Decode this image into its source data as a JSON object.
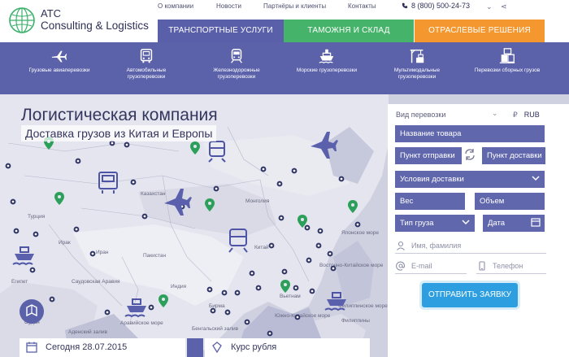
{
  "brand": {
    "line1": "ATC",
    "line2": "Consulting & Logistics"
  },
  "topnav": [
    "О компании",
    "Новости",
    "Партнёры и клиенты",
    "Контакты"
  ],
  "phone": "8 (800) 500-24-73",
  "tabs": [
    {
      "label": "ТРАНСПОРТНЫЕ УСЛУГИ",
      "color": "#595fa8"
    },
    {
      "label": "ТАМОЖНЯ И СКЛАД",
      "color": "#46b36b"
    },
    {
      "label": "ОТРАСЛЕВЫЕ РЕШЕНИЯ",
      "color": "#f4972e"
    }
  ],
  "services": [
    {
      "label": "Грузовые авиаперевозки",
      "icon": "airplane-icon"
    },
    {
      "label": "Автомобильные грузоперевозки",
      "icon": "truck-icon"
    },
    {
      "label": "Железнодорожные грузоперевозки",
      "icon": "train-icon"
    },
    {
      "label": "Морские грузоперевозки",
      "icon": "ship-icon"
    },
    {
      "label": "Мультимодальные грузоперевозки",
      "icon": "crane-icon"
    },
    {
      "label": "Перевозки сборных грузов",
      "icon": "boxes-icon"
    }
  ],
  "hero": {
    "title": "Логистическая компания",
    "subtitle": "Доставка грузов из Китая и Европы"
  },
  "map_labels": [
    "Казахстан",
    "Монголия",
    "Китай",
    "Японское море",
    "Восточно-Китайское море",
    "Южно-Китайское море",
    "Бирма",
    "Аравийское море",
    "Бенгальский залив",
    "Филиппинское море",
    "Египет",
    "Аденский залив",
    "Судан",
    "Пакистан",
    "Индия",
    "Иран",
    "Ирак",
    "Турция",
    "Вьетнам",
    "Филиппины",
    "Саудовская Аравия"
  ],
  "bottom": {
    "date_label": "Сегодня 28.07.2015",
    "rate_label": "Курс рубля"
  },
  "form": {
    "transport_type_label": "Вид перевозки",
    "currency": "RUB",
    "product_name": "Название товара",
    "from": "Пункт отправки",
    "to": "Пункт доставки",
    "delivery_terms": "Условия доставки",
    "weight": "Вес",
    "volume": "Объем",
    "cargo_type": "Тип груза",
    "date": "Дата",
    "name_placeholder": "Имя, фамилия",
    "email_placeholder": "E-mail",
    "phone_placeholder": "Телефон",
    "submit": "ОТПРАВИТЬ ЗАЯВКУ"
  },
  "colors": {
    "primary": "#5c62aa",
    "green": "#46b36b",
    "orange": "#f4972e",
    "cta": "#2d9fe0"
  }
}
